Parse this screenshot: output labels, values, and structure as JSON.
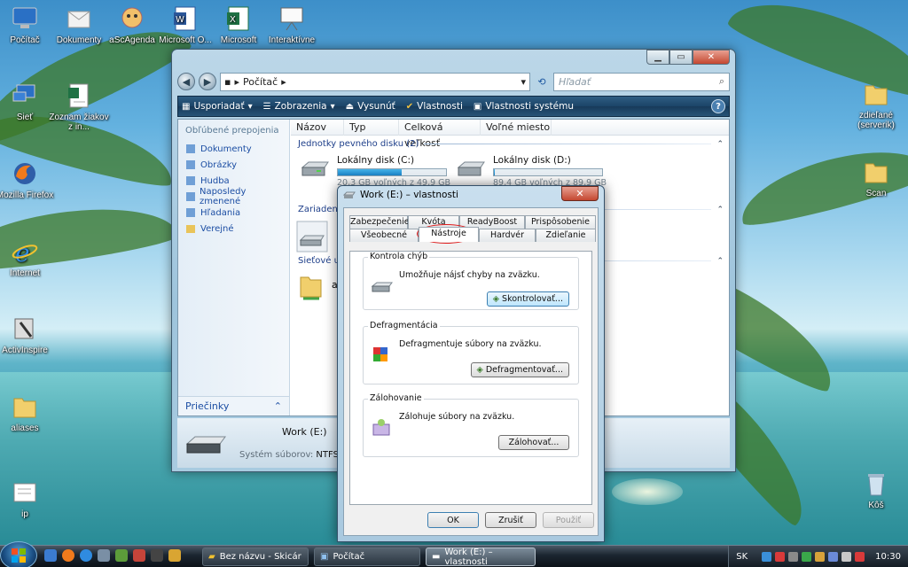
{
  "desktop": {
    "icons_left": [
      {
        "label": "Počítač",
        "icon": "computer-icon"
      },
      {
        "label": "Dokumenty",
        "icon": "documents-icon"
      },
      {
        "label": "aScAgenda",
        "icon": "ascagenda-icon"
      },
      {
        "label": "Microsoft O...",
        "icon": "word-icon"
      },
      {
        "label": "Microsoft",
        "icon": "excel-icon"
      },
      {
        "label": "Interaktívne",
        "icon": "whiteboard-icon"
      },
      {
        "label": "Sieť",
        "icon": "network-icon"
      },
      {
        "label": "Zoznam žiakov z in...",
        "icon": "excel-file-icon"
      },
      {
        "label": "Mozilla Firefox",
        "icon": "firefox-icon"
      },
      {
        "label": "Internet",
        "icon": "ie-icon"
      },
      {
        "label": "ActivInspire",
        "icon": "activinspire-icon"
      },
      {
        "label": "aliases",
        "icon": "folder-icon"
      },
      {
        "label": "ip",
        "icon": "file-icon"
      }
    ],
    "icons_right": [
      {
        "label": "zdieľané (serverik)",
        "icon": "shared-folder-icon"
      },
      {
        "label": "Scan",
        "icon": "folder-icon"
      },
      {
        "label": "Kôš",
        "icon": "recycle-bin-icon"
      }
    ]
  },
  "explorer": {
    "address_path": "Počítač",
    "search_placeholder": "Hľadať",
    "toolbar": [
      "Usporiadať",
      "Zobrazenia",
      "Vysunúť",
      "Vlastnosti",
      "Vlastnosti systému"
    ],
    "nav_header": "Obľúbené prepojenia",
    "nav_items": [
      "Dokumenty",
      "Obrázky",
      "Hudba",
      "Naposledy zmenené",
      "Hľadania",
      "Verejné"
    ],
    "folders_label": "Priečinky",
    "columns": [
      "Názov",
      "Typ",
      "Celková veľkosť",
      "Voľné miesto"
    ],
    "groups": {
      "hdd": "Jednotky pevného disku (2)",
      "removable": "Zariadenia",
      "network": "Sieťové um"
    },
    "drives": [
      {
        "name": "Lokálny disk (C:)",
        "free_text": "20,3 GB voľných z 49,9 GB",
        "used_fraction": 0.59
      },
      {
        "name": "Lokálny disk (D:)",
        "free_text": "89,4 GB voľných z 89,9 GB",
        "used_fraction": 0.01
      }
    ],
    "network_item": "a",
    "details": {
      "name": "Work (E:)",
      "fs_label": "Systém súborov:",
      "fs_value": "NTFS"
    }
  },
  "dialog": {
    "title": "Work (E:) – vlastnosti",
    "tabs_row1": [
      "Zabezpečenie",
      "Kvóta",
      "ReadyBoost",
      "Prispôsobenie"
    ],
    "tabs_row2": [
      "Všeobecné",
      "Nástroje",
      "Hardvér",
      "Zdieľanie"
    ],
    "active_tab": "Nástroje",
    "sections": [
      {
        "legend": "Kontrola chýb",
        "desc": "Umožňuje nájsť chyby na zväzku.",
        "button": "Skontrolovať..."
      },
      {
        "legend": "Defragmentácia",
        "desc": "Defragmentuje súbory na zväzku.",
        "button": "Defragmentovať..."
      },
      {
        "legend": "Zálohovanie",
        "desc": "Zálohuje súbory na zväzku.",
        "button": "Zálohovať..."
      }
    ],
    "buttons": {
      "ok": "OK",
      "cancel": "Zrušiť",
      "apply": "Použiť"
    }
  },
  "taskbar": {
    "tasks": [
      "Bez názvu - Skicár",
      "Počítač",
      "Work (E:) – vlastnosti"
    ],
    "active_task": "Work (E:) – vlastnosti",
    "language": "SK",
    "clock": "10:30"
  }
}
